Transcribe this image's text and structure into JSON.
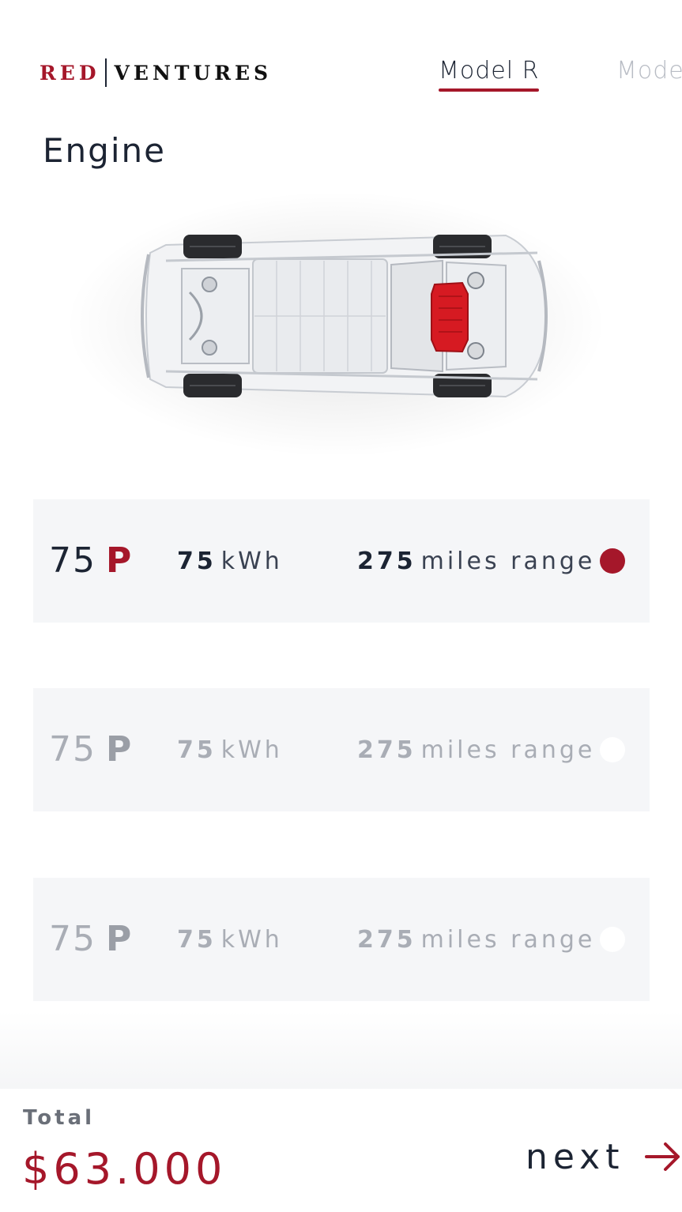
{
  "brand": {
    "part1": "RED",
    "part2": "VENTURES"
  },
  "tabs": [
    {
      "label": "Model R",
      "active": true
    },
    {
      "label": "Model",
      "active": false
    }
  ],
  "section_title": "Engine",
  "options": [
    {
      "code_number": "75",
      "code_letter": "P",
      "kwh_value": "75",
      "kwh_unit": "kWh",
      "range_value": "275",
      "range_unit": "miles range",
      "selected": true
    },
    {
      "code_number": "75",
      "code_letter": "P",
      "kwh_value": "75",
      "kwh_unit": "kWh",
      "range_value": "275",
      "range_unit": "miles range",
      "selected": false
    },
    {
      "code_number": "75",
      "code_letter": "P",
      "kwh_value": "75",
      "kwh_unit": "kWh",
      "range_value": "275",
      "range_unit": "miles range",
      "selected": false
    }
  ],
  "footer": {
    "total_label": "Total",
    "price": "$63.000",
    "next_label": "next"
  },
  "colors": {
    "accent": "#a5172a",
    "text": "#1c2433",
    "card": "#f5f6f8"
  },
  "icons": {
    "next": "arrow-right-icon",
    "car": "car-chassis-image"
  }
}
